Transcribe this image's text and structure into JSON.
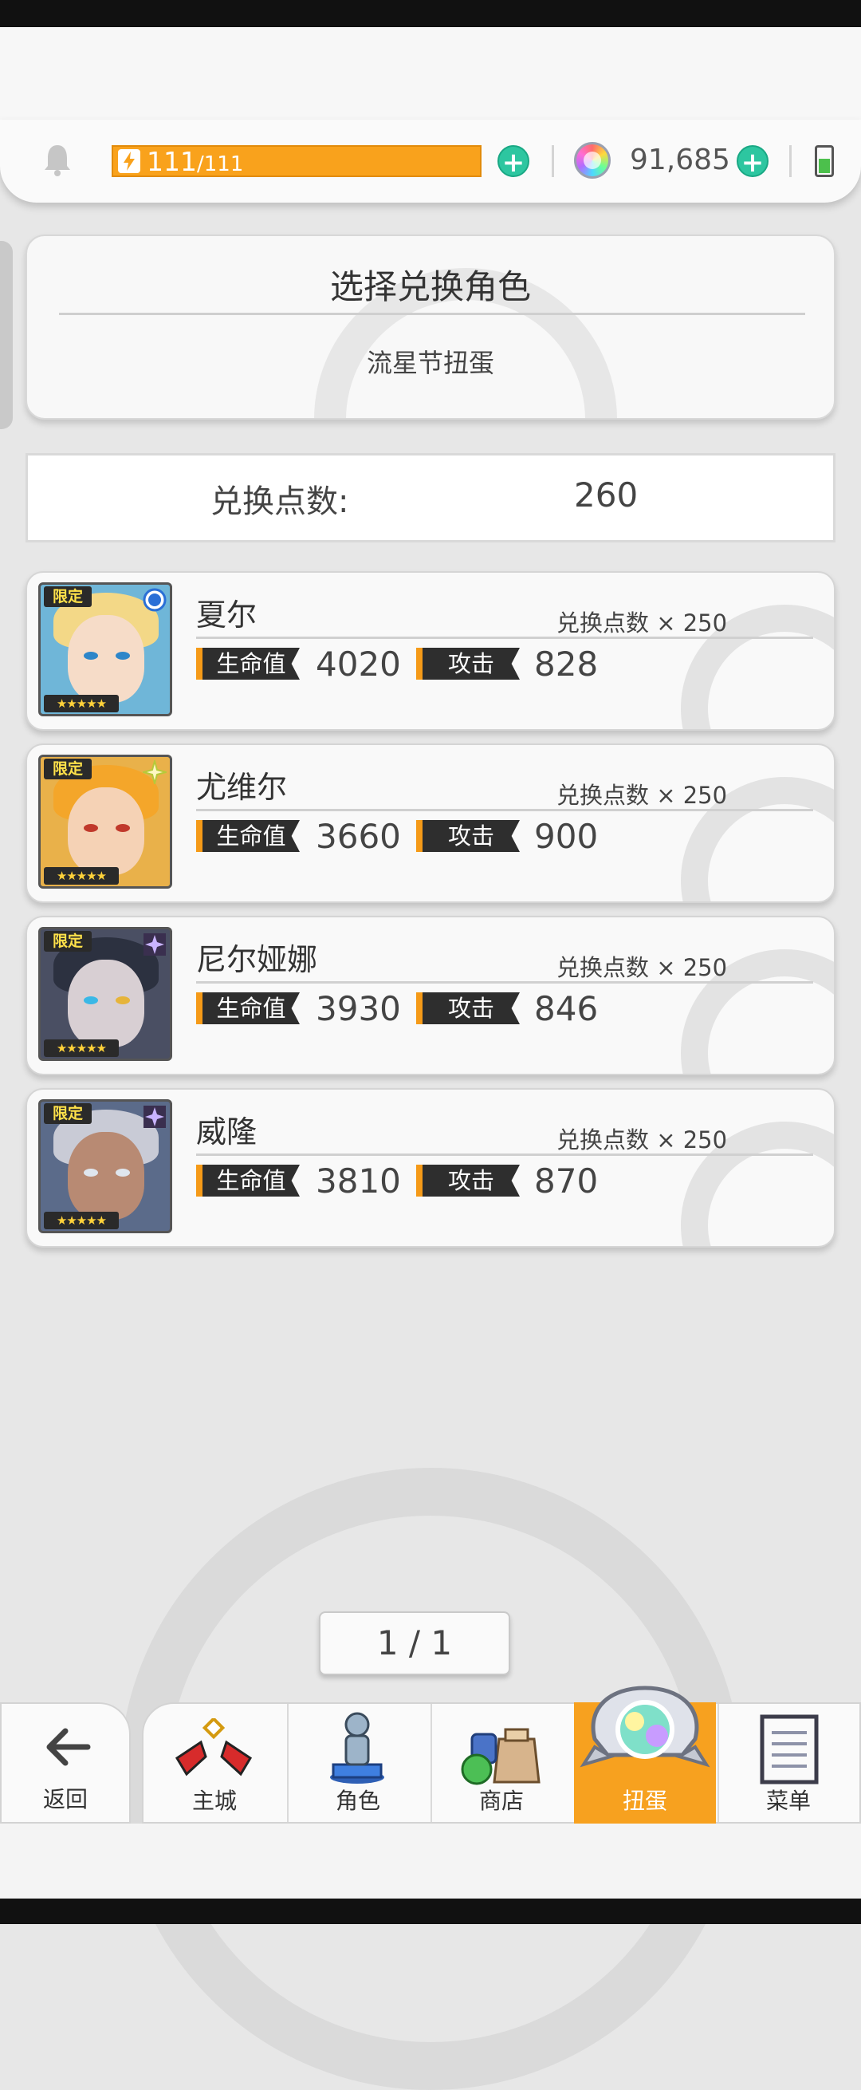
{
  "header": {
    "stamina_current": "111",
    "stamina_max": "/111",
    "gems": "91,685",
    "icons": [
      "bell-icon",
      "bolt-icon",
      "plus-icon",
      "gem-icon",
      "battery-icon"
    ]
  },
  "panel": {
    "title": "选择兑换角色",
    "subtitle": "流星节扭蛋"
  },
  "points": {
    "label": "兑换点数:",
    "value": "260"
  },
  "characters": [
    {
      "name": "夏尔",
      "cost": "兑换点数 × 250",
      "hp_label": "生命值",
      "hp": "4020",
      "atk_label": "攻击",
      "atk": "828",
      "tag": "限定",
      "stars": "★★★★★",
      "element": "water"
    },
    {
      "name": "尤维尔",
      "cost": "兑换点数 × 250",
      "hp_label": "生命值",
      "hp": "3660",
      "atk_label": "攻击",
      "atk": "900",
      "tag": "限定",
      "stars": "★★★★★",
      "element": "light"
    },
    {
      "name": "尼尔娅娜",
      "cost": "兑换点数 × 250",
      "hp_label": "生命值",
      "hp": "3930",
      "atk_label": "攻击",
      "atk": "846",
      "tag": "限定",
      "stars": "★★★★★",
      "element": "dark"
    },
    {
      "name": "威隆",
      "cost": "兑换点数 × 250",
      "hp_label": "生命值",
      "hp": "3810",
      "atk_label": "攻击",
      "atk": "870",
      "tag": "限定",
      "stars": "★★★★★",
      "element": "dark"
    }
  ],
  "pagination": {
    "text": "1 / 1"
  },
  "nav": {
    "back": "返回",
    "items": [
      "主城",
      "角色",
      "商店",
      "扭蛋",
      "菜单"
    ],
    "active": "扭蛋"
  },
  "colors": {
    "accent": "#f7a11f",
    "plus": "#2dc6a0",
    "background": "#e7e7e7"
  }
}
